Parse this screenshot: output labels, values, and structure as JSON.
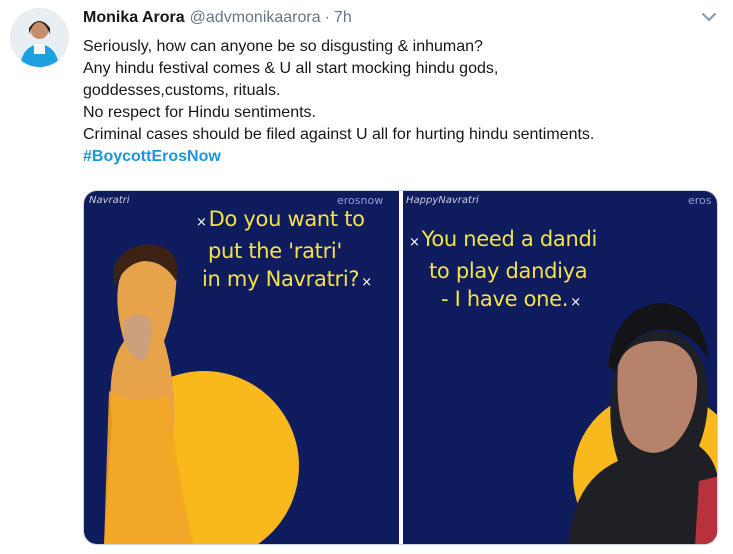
{
  "tweet": {
    "name": "Monika Arora",
    "handle": "@advmonikaarora",
    "separator": "·",
    "time": "7h",
    "lines": [
      "Seriously, how can anyone be so disgusting & inhuman?",
      "Any hindu festival comes & U all start mocking hindu gods,",
      "goddesses,customs, rituals.",
      "No respect for Hindu sentiments.",
      "Criminal cases should be filed against U all for hurting hindu sentiments."
    ],
    "hashtag": "#BoycottErosNow"
  },
  "media": {
    "left": {
      "tag": "Navratri",
      "brand": "erosnow",
      "quote_lines": [
        "Do you want to",
        "put the 'ratri'",
        "in my Navratri?"
      ],
      "mark": "×"
    },
    "right": {
      "tag": "HappyNavratri",
      "brand": "eros",
      "quote_lines": [
        "You need a dandi",
        "to play dandiya",
        "- I have one."
      ],
      "mark": "×"
    }
  },
  "colors": {
    "name": "#14171a",
    "secondary": "#657786",
    "hashtag": "#1b95e0",
    "poster_bg": "#0e1b5c",
    "poster_accent": "#f9b81b",
    "quote_text": "#f4e24a"
  },
  "icons": [
    "avatar",
    "chevron-down-icon"
  ]
}
